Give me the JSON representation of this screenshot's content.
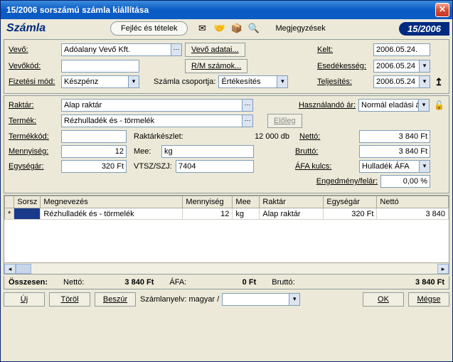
{
  "window": {
    "title": "15/2006 sorszámú számla kiállítása"
  },
  "header": {
    "app_label": "Számla",
    "tab_main": "Fejléc és tételek",
    "tab_notes": "Megjegyzések",
    "doc_number": "15/2006"
  },
  "top": {
    "vevo_lbl": "Vevő:",
    "vevo_val": "Adóalany Vevő Kft.",
    "vevo_adatai_btn": "Vevő adatai...",
    "vevokod_lbl": "Vevőkód:",
    "vevokod_val": "",
    "rm_btn": "R/M számok...",
    "fizmod_lbl": "Fizetési mód:",
    "fizmod_val": "Készpénz",
    "csoport_lbl": "Számla csoportja:",
    "csoport_val": "Értékesítés",
    "kelt_lbl": "Kelt:",
    "kelt_val": "2006.05.24.",
    "esed_lbl": "Esedékesség:",
    "esed_val": "2006.05.24",
    "telj_lbl": "Teljesítés:",
    "telj_val": "2006.05.24"
  },
  "item": {
    "raktar_lbl": "Raktár:",
    "raktar_val": "Alap raktár",
    "haszn_ar_lbl": "Használandó ár:",
    "haszn_ar_val": "Normál eladási á",
    "termek_lbl": "Termék:",
    "termek_val": "Rézhulladék és - törmelék",
    "eloleg_btn": "Előleg",
    "termekkod_lbl": "Termékkód:",
    "termekkod_val": "",
    "raktarkeszlet_lbl": "Raktárkészlet:",
    "raktarkeszlet_val": "12 000 db",
    "netto_lbl": "Nettó:",
    "netto_val": "3 840 Ft",
    "mennyiseg_lbl": "Mennyiség:",
    "mennyiseg_val": "12",
    "mee_lbl": "Mee:",
    "mee_val": "kg",
    "brutto_lbl": "Bruttó:",
    "brutto_val": "3 840 Ft",
    "egysegar_lbl": "Egységár:",
    "egysegar_val": "320 Ft",
    "vtsz_lbl": "VTSZ/SZJ:",
    "vtsz_val": "7404",
    "afa_lbl": "ÁFA kulcs:",
    "afa_val": "Hulladék ÁFA",
    "engedmeny_lbl": "Engedmény/felár:",
    "engedmeny_val": "0,00 %"
  },
  "grid": {
    "cols": {
      "sorsz": "Sorsz",
      "megnev": "Megnevezés",
      "menny": "Mennyiség",
      "mee": "Mee",
      "raktar": "Raktár",
      "egysegar": "Egységár",
      "netto": "Nettó"
    },
    "rows": [
      {
        "megnev": "Rézhulladék és - törmelék",
        "menny": "12",
        "mee": "kg",
        "raktar": "Alap raktár",
        "egysegar": "320 Ft",
        "netto": "3 840"
      }
    ]
  },
  "totals": {
    "osszesen": "Összesen:",
    "netto_lbl": "Nettó:",
    "netto_val": "3 840 Ft",
    "afa_lbl": "ÁFA:",
    "afa_val": "0 Ft",
    "brutto_lbl": "Bruttó:",
    "brutto_val": "3 840 Ft"
  },
  "footer": {
    "uj": "Új",
    "torol": "Töröl",
    "beszur": "Beszúr",
    "lang_lbl": "Számlanyelv: magyar /",
    "lang_val": "",
    "ok": "OK",
    "megse": "Mégse"
  }
}
